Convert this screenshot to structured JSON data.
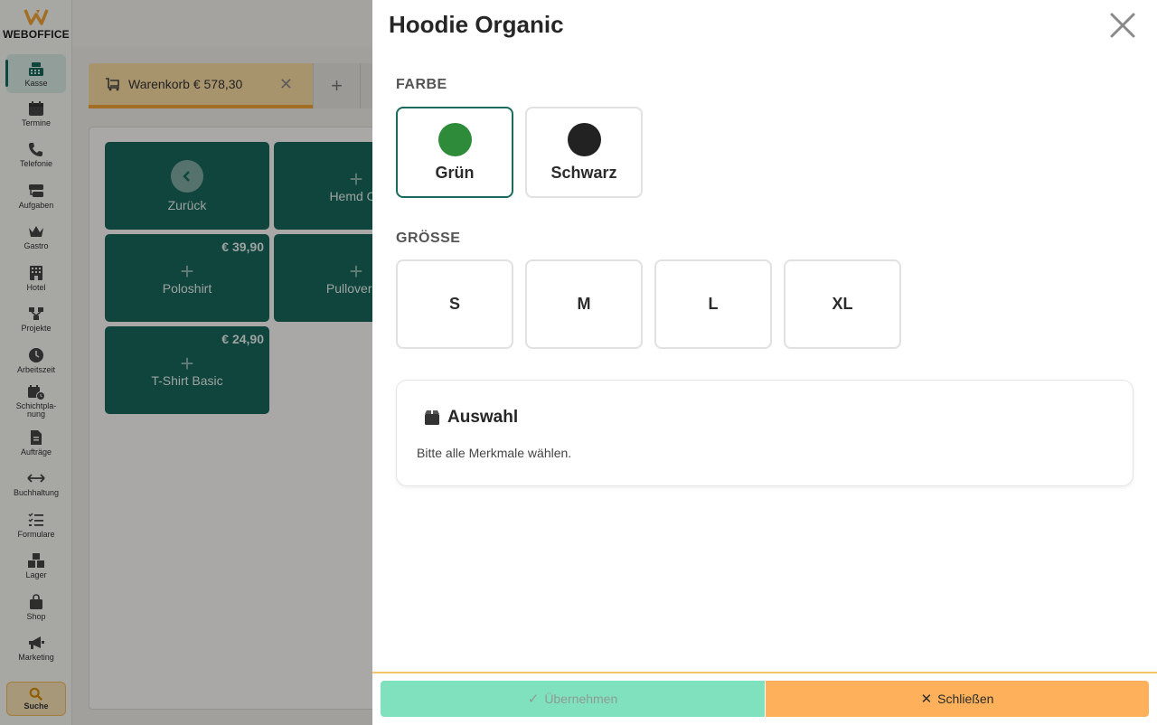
{
  "sidebar": {
    "brand": "WEBOFFICE",
    "items": [
      {
        "label": "Kasse",
        "icon": "cash-register-icon",
        "active": true
      },
      {
        "label": "Termine",
        "icon": "calendar-icon"
      },
      {
        "label": "Telefonie",
        "icon": "phone-icon"
      },
      {
        "label": "Aufgaben",
        "icon": "tasks-icon"
      },
      {
        "label": "Gastro",
        "icon": "crown-icon"
      },
      {
        "label": "Hotel",
        "icon": "hotel-icon"
      },
      {
        "label": "Projekte",
        "icon": "projects-icon"
      },
      {
        "label": "Arbeitszeit",
        "icon": "clock-icon"
      },
      {
        "label": "Schichtpla-",
        "label2": "nung",
        "icon": "shift-calendar-icon"
      },
      {
        "label": "Aufträge",
        "icon": "document-icon"
      },
      {
        "label": "Buchhaltung",
        "icon": "exchange-icon"
      },
      {
        "label": "Formulare",
        "icon": "checklist-icon"
      },
      {
        "label": "Lager",
        "icon": "boxes-icon"
      },
      {
        "label": "Shop",
        "icon": "shopping-bag-icon"
      },
      {
        "label": "Marketing",
        "icon": "megaphone-icon"
      }
    ],
    "search_label": "Suche"
  },
  "tabs": {
    "cart_label": "Warenkorb € 578,30",
    "add": "+"
  },
  "tiles": [
    {
      "label": "Zurück",
      "kind": "back"
    },
    {
      "label": "Hemd Ox",
      "kind": "plus"
    },
    {
      "label": "Poloshirt",
      "price": "€ 39,90",
      "kind": "plus"
    },
    {
      "label": "Pullover M",
      "kind": "plus"
    },
    {
      "label": "T-Shirt Basic",
      "price": "€ 24,90",
      "kind": "plus"
    }
  ],
  "modal": {
    "title": "Hoodie Organic",
    "color_section": "FARBE",
    "colors": [
      {
        "label": "Grün",
        "swatch": "#2e8b3a",
        "selected": true
      },
      {
        "label": "Schwarz",
        "swatch": "#222222",
        "selected": false
      }
    ],
    "size_section": "GRÖSSE",
    "sizes": [
      "S",
      "M",
      "L",
      "XL"
    ],
    "summary_title": "Auswahl",
    "summary_text": "Bitte alle Merkmale wählen.",
    "apply_label": "Übernehmen",
    "close_label": "Schließen"
  },
  "colors": {
    "primary": "#17665a",
    "accent": "#f0a336",
    "apply_bg": "#80e1be",
    "close_bg": "#ffb05a"
  }
}
